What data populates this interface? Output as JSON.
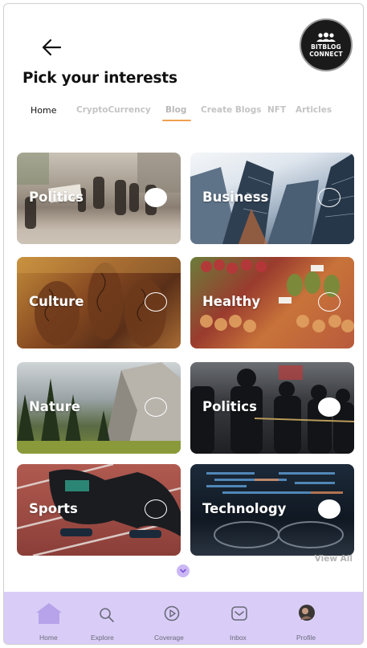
{
  "header": {
    "back_icon": "arrow-left-icon",
    "logo": {
      "line1": "BITBLOG",
      "line2": "CONNECT"
    },
    "title": "Pick your interests"
  },
  "tabs": [
    {
      "label": "Home",
      "state": "active"
    },
    {
      "label": "CryptoCurrency",
      "state": "inactive"
    },
    {
      "label": "Blog",
      "state": "underlined"
    },
    {
      "label": "Create Blogs",
      "state": "inactive"
    },
    {
      "label": "NFT",
      "state": "inactive"
    },
    {
      "label": "Articles",
      "state": "inactive"
    }
  ],
  "interests": [
    {
      "label": "Politics",
      "selected": true
    },
    {
      "label": "Business",
      "selected": false
    },
    {
      "label": "Culture",
      "selected": false
    },
    {
      "label": "Healthy",
      "selected": false
    },
    {
      "label": "Nature",
      "selected": false
    },
    {
      "label": "Politics",
      "selected": true
    },
    {
      "label": "Sports",
      "selected": false
    },
    {
      "label": "Technology",
      "selected": true
    }
  ],
  "view_all": "View All",
  "bottom_nav": [
    {
      "label": "Home",
      "icon": "home-icon"
    },
    {
      "label": "Explore",
      "icon": "search-icon"
    },
    {
      "label": "Coverage",
      "icon": "play-circle-icon"
    },
    {
      "label": "Inbox",
      "icon": "inbox-icon"
    },
    {
      "label": "Profile",
      "icon": "avatar-icon"
    }
  ],
  "colors": {
    "accent_underline": "#f0a050",
    "nav_background": "#d9cdf8",
    "scroll_button": "#cbb8f5"
  }
}
